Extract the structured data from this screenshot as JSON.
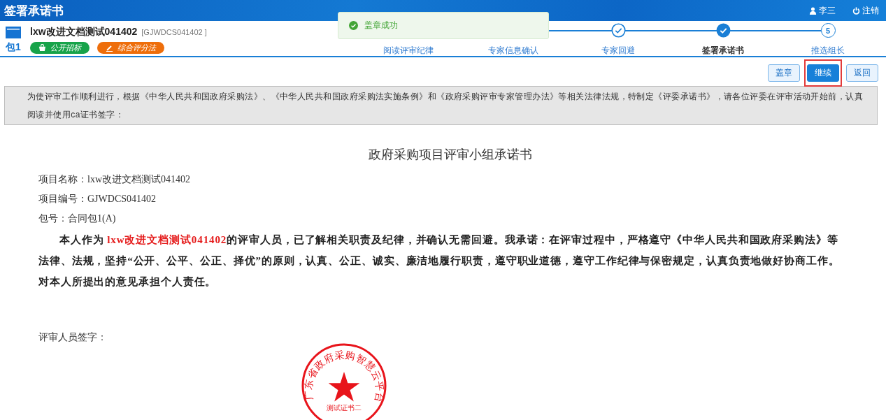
{
  "header": {
    "title": "签署承诺书",
    "user": "李三",
    "logout": "注销"
  },
  "project": {
    "name": "lxw改进文档测试041402",
    "code": "[GJWDCS041402 ]",
    "package": "包1",
    "tags": [
      {
        "kind": "method",
        "label": "公开招标",
        "color": "#17a34a"
      },
      {
        "kind": "scoring",
        "label": "综合评分法",
        "color": "#ee6e0b"
      }
    ]
  },
  "steps": [
    {
      "label": "阅读评审纪律",
      "selected": false
    },
    {
      "label": "专家信息确认",
      "selected": false
    },
    {
      "label": "专家回避",
      "completed": true,
      "selected": false
    },
    {
      "label": "签署承诺书",
      "completed": true,
      "selected": true
    },
    {
      "label": "推选组长",
      "number": "5",
      "completed": false,
      "selected": false
    }
  ],
  "toast": {
    "message": "盖章成功"
  },
  "buttons": [
    {
      "label": "盖章",
      "primary": false,
      "highlighted": false
    },
    {
      "label": "继续",
      "primary": true,
      "highlighted": true
    },
    {
      "label": "返回",
      "primary": false,
      "highlighted": false
    }
  ],
  "notice": "为使评审工作顺利进行，根据《中华人民共和国政府采购法》、《中华人民共和国政府采购法实施条例》和《政府采购评审专家管理办法》等相关法律法规，特制定《评委承诺书》，请各位评委在评审活动开始前，认真阅读并使用ca证书签字：",
  "document": {
    "title": "政府采购项目评审小组承诺书",
    "fields": [
      "项目名称：lxw改进文档测试041402",
      "项目编号：GJWDCS041402",
      "包号：合同包1(A)"
    ],
    "pledge": [
      {
        "text": "本人作为 ",
        "highlight": false
      },
      {
        "text": "lxw改进文档测试041402",
        "highlight": true
      },
      {
        "text": "的评审人员，已了解相关职责及纪律，并确认无需回避。我承诺：在评审过程中，严格遵守《中华人民共和国政府采购法》等法律、法规，坚持“公开、公平、公正、择优”的原则，认真、公正、诚实、廉洁地履行职责，遵守职业道德，遵守工作纪律与保密规定，认真负责地做好协商工作。对本人所提出的意见承担个人责任。",
        "highlight": false
      }
    ],
    "signature_label": "评审人员签字：",
    "seal": {
      "ring_text": "广东省政府采购智慧云平台",
      "bottom_text": "测试证书二"
    }
  }
}
